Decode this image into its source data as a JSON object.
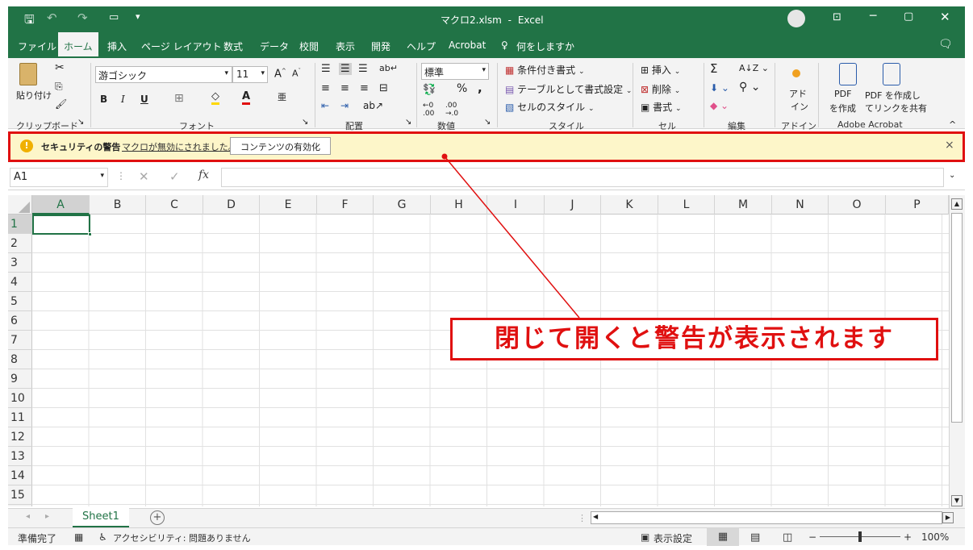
{
  "titlebar": {
    "filename": "マクロ2.xlsm",
    "sep": "-",
    "app": "Excel"
  },
  "tabs": [
    {
      "label": "ファイル"
    },
    {
      "label": "ホーム"
    },
    {
      "label": "挿入"
    },
    {
      "label": "ページ レイアウト"
    },
    {
      "label": "数式"
    },
    {
      "label": "データ"
    },
    {
      "label": "校閲"
    },
    {
      "label": "表示"
    },
    {
      "label": "開発"
    },
    {
      "label": "ヘルプ"
    },
    {
      "label": "Acrobat"
    },
    {
      "label": "何をしますか"
    }
  ],
  "ribbon": {
    "clipboard": {
      "paste": "貼り付け",
      "group": "クリップボード"
    },
    "font": {
      "name": "游ゴシック",
      "size": "11",
      "bold": "B",
      "italic": "I",
      "underline": "U",
      "group": "フォント"
    },
    "alignment": {
      "group": "配置"
    },
    "number": {
      "format": "標準",
      "percent": "%",
      "comma": ",",
      "group": "数値"
    },
    "styles": {
      "conditional": "条件付き書式",
      "table": "テーブルとして書式設定",
      "cell": "セルのスタイル",
      "group": "スタイル"
    },
    "cells": {
      "insert": "挿入",
      "delete": "削除",
      "format": "書式",
      "group": "セル"
    },
    "editing": {
      "sum": "Σ",
      "group": "編集"
    },
    "addins": {
      "label1": "アド",
      "label2": "イン",
      "group": "アドイン"
    },
    "acrobat": {
      "pdf1a": "PDF",
      "pdf1b": "を作成",
      "pdf2a": "PDF を作成し",
      "pdf2b": "てリンクを共有",
      "group": "Adobe Acrobat"
    }
  },
  "security": {
    "title": "セキュリティの警告",
    "message": "マクロが無効にされました。",
    "button": "コンテンツの有効化",
    "close": "×"
  },
  "formula": {
    "namebox": "A1",
    "fx": "fx",
    "cancel": "✕",
    "enter": "✓"
  },
  "columns": [
    "A",
    "B",
    "C",
    "D",
    "E",
    "F",
    "G",
    "H",
    "I",
    "J",
    "K",
    "L",
    "M",
    "N",
    "O",
    "P"
  ],
  "rows": [
    "1",
    "2",
    "3",
    "4",
    "5",
    "6",
    "7",
    "8",
    "9",
    "10",
    "11",
    "12",
    "13",
    "14",
    "15"
  ],
  "sheet": {
    "name": "Sheet1",
    "add": "+"
  },
  "status": {
    "ready": "準備完了",
    "accessibility": "アクセシビリティ: 問題ありません",
    "display": "表示設定",
    "minus": "−",
    "plus": "+",
    "zoom": "100%"
  },
  "callout": {
    "text": "閉じて開くと警告が表示されます"
  },
  "colors": {
    "excel_green": "#217346",
    "warning_yellow": "#fdf6c9",
    "annotation_red": "#e01010"
  }
}
